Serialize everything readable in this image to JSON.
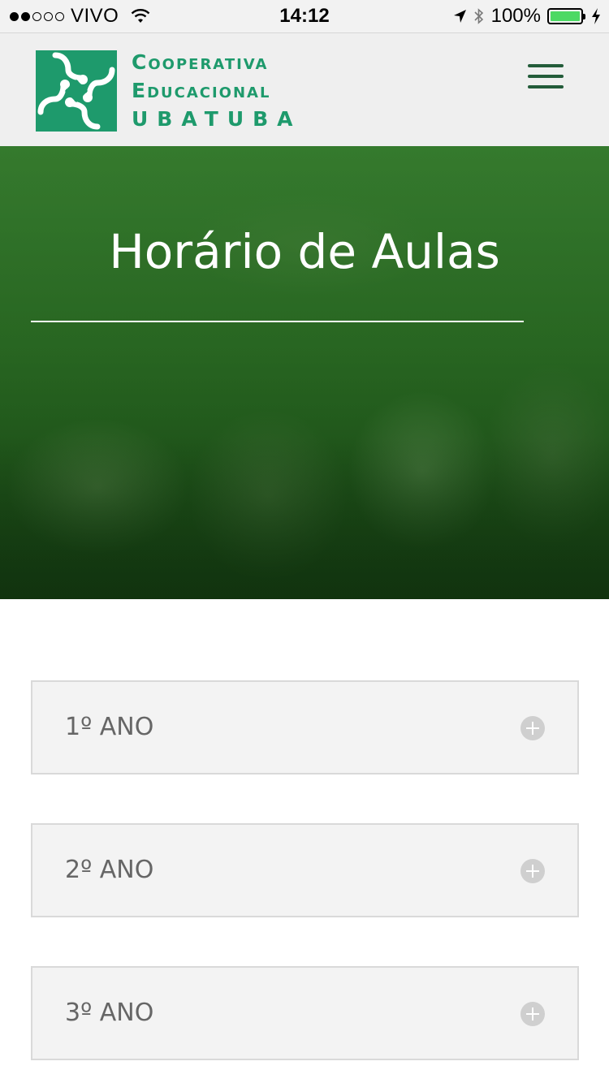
{
  "status_bar": {
    "carrier": "VIVO",
    "time": "14:12",
    "battery": "100%",
    "signal_strength": 2,
    "battery_level": 1.0,
    "icons": [
      "wifi-icon",
      "location-arrow-icon",
      "bluetooth-icon",
      "battery-icon",
      "charging-bolt-icon"
    ]
  },
  "header": {
    "logo_lines": [
      "Cooperativa",
      "Educacional",
      "UBATUBA"
    ],
    "logo_color": "#1e9a6c",
    "menu_icon": "hamburger-menu-icon",
    "menu_color": "#235c3a"
  },
  "hero": {
    "title": "Horário de Aulas",
    "overlay_color": "#2f6a27"
  },
  "accordion": {
    "items": [
      {
        "label": "1º ANO",
        "icon": "plus-circle-icon"
      },
      {
        "label": "2º ANO",
        "icon": "plus-circle-icon"
      },
      {
        "label": "3º ANO",
        "icon": "plus-circle-icon"
      }
    ]
  }
}
